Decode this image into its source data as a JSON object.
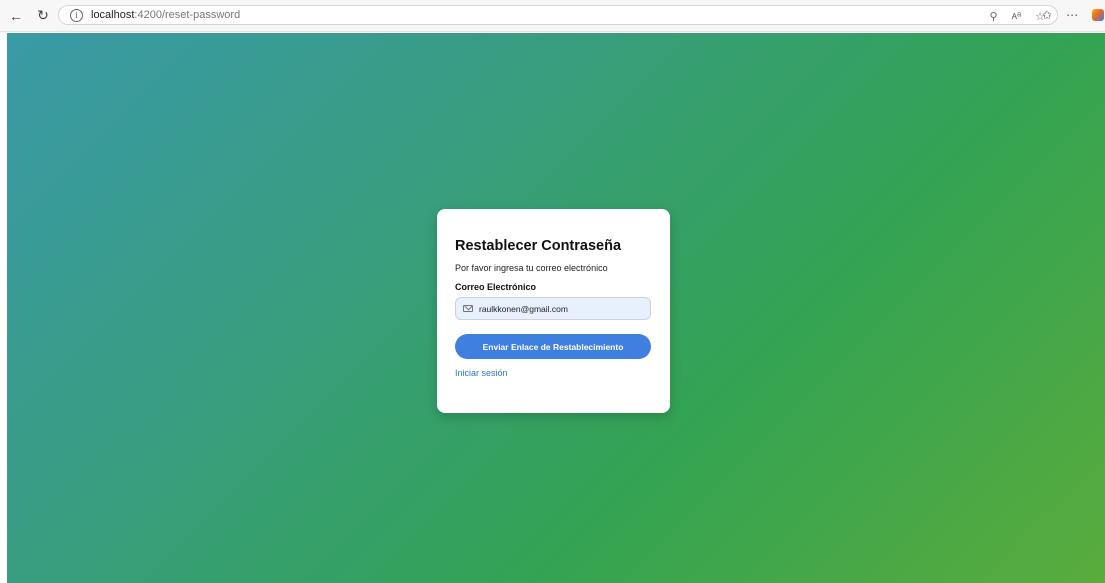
{
  "browser": {
    "url_host": "localhost",
    "url_path": ":4200/reset-password",
    "back_icon": "back-arrow-icon",
    "reload_icon": "reload-icon"
  },
  "background": {
    "gradient_colors": [
      "#3a9aa7",
      "#33a353",
      "#5aac3c"
    ]
  },
  "card": {
    "title": "Restablecer Contraseña",
    "subtitle": "Por favor ingresa tu correo electrónico",
    "email_label": "Correo Electrónico",
    "email_value": "raulkkonen@gmail.com",
    "submit_label": "Enviar Enlace de Restablecimiento",
    "login_link": "Iniciar sesión"
  },
  "colors": {
    "accent": "#3f7fe0",
    "link": "#2a7bc4",
    "input_bg": "#e8f0fe"
  }
}
